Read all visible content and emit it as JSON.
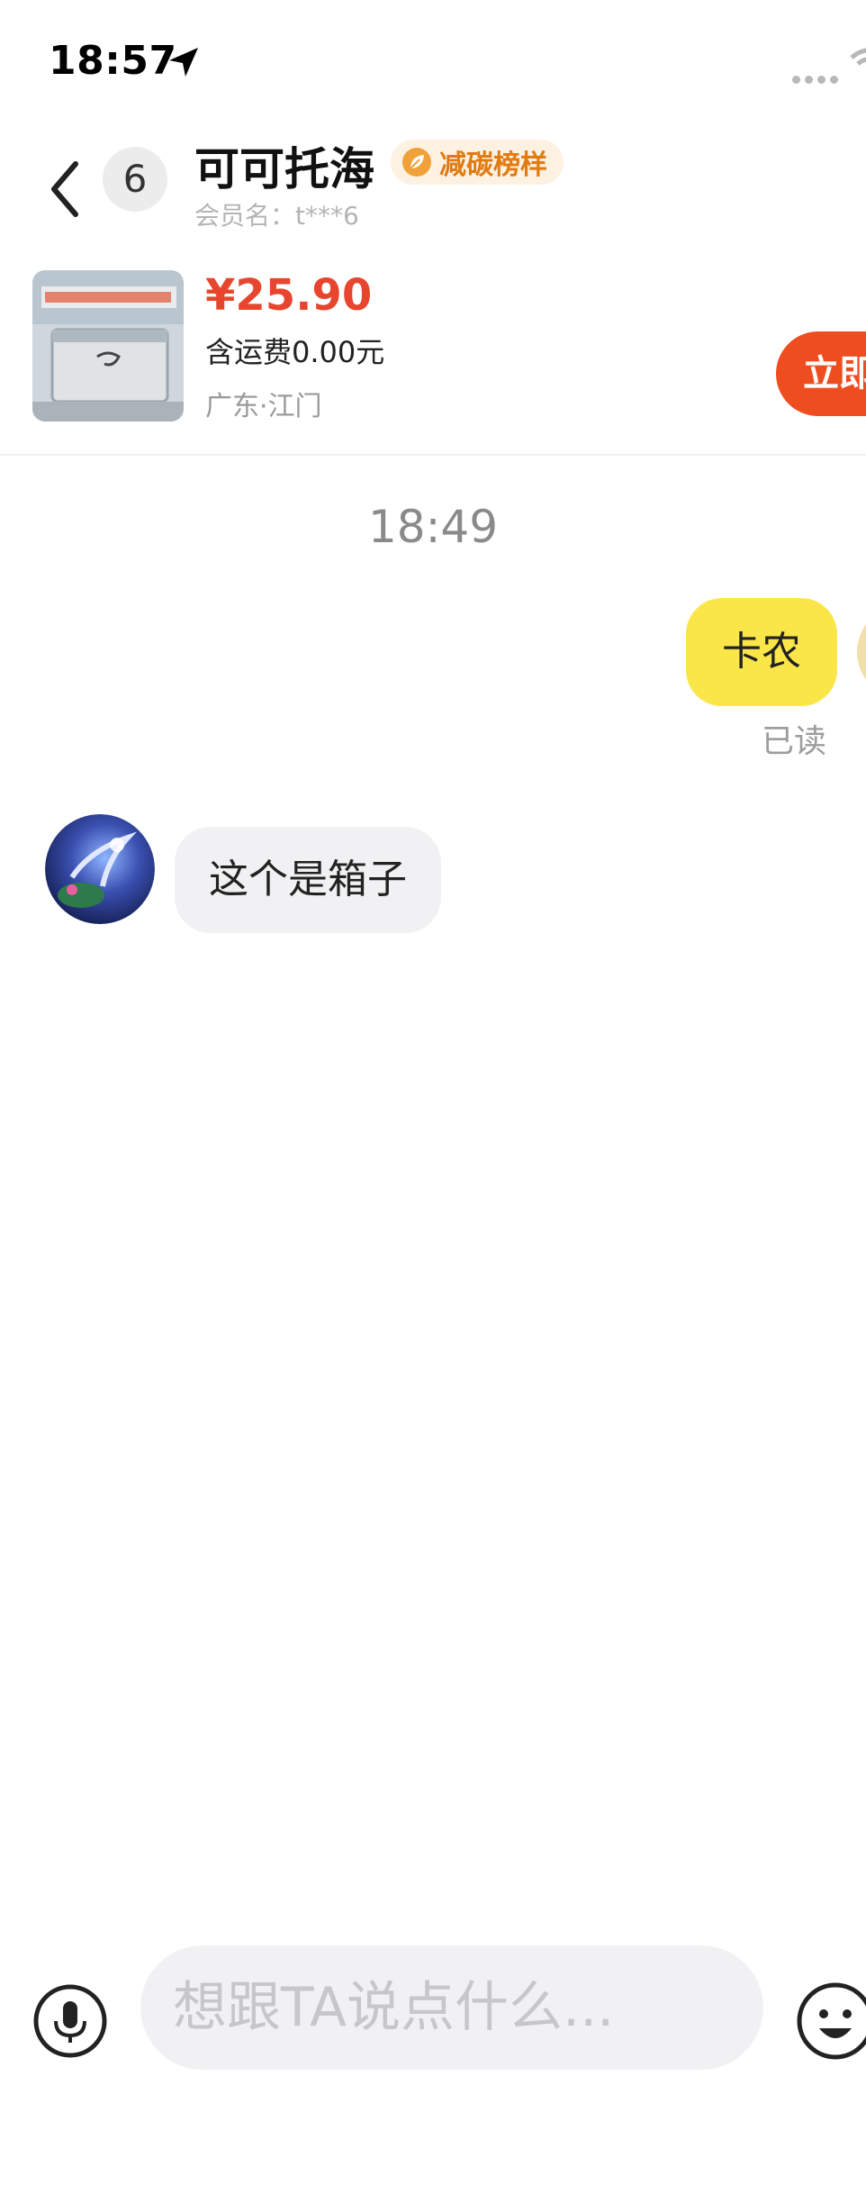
{
  "status_bar": {
    "time": "18:57"
  },
  "header": {
    "unread_count": "6",
    "contact_name": "可可托海",
    "tag_label": "减碳榜样",
    "member_line": "会员名：t***6"
  },
  "product": {
    "price": "¥25.90",
    "shipping": "含运费0.00元",
    "location": "广东·江门",
    "buy_label": "立即"
  },
  "chat": {
    "timestamp": "18:49",
    "messages": [
      {
        "side": "right",
        "text": "卡农",
        "status": "已读"
      },
      {
        "side": "left",
        "text": "这个是箱子"
      }
    ]
  },
  "input_bar": {
    "placeholder": "想跟TA说点什么..."
  },
  "colors": {
    "accent_orange": "#ee4d20",
    "price_red": "#e8452e",
    "my_bubble": "#fbe64a",
    "peer_bubble": "#f1f1f3",
    "tag_text": "#e07b12"
  },
  "icons": {
    "back": "chevron-left-icon",
    "location_arrow": "location-arrow-icon",
    "voice": "microphone-icon",
    "emoji": "smiley-icon",
    "tag": "leaf-badge-icon"
  }
}
